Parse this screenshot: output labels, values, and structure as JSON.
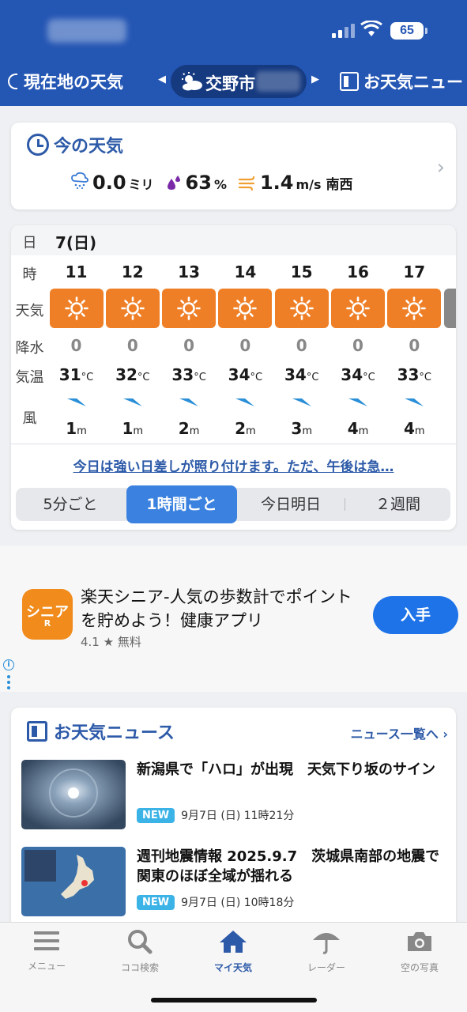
{
  "status_bar": {
    "battery": "65"
  },
  "nav": {
    "left_label": "現在地の天気",
    "city": "交野市",
    "right_label": "お天気ニュー"
  },
  "current": {
    "title": "今の天気",
    "precip_value": "0.0",
    "precip_unit": "ミリ",
    "humidity_value": "63",
    "humidity_unit": "%",
    "wind_value": "1.4",
    "wind_unit": "m/s",
    "wind_dir": "南西"
  },
  "hourly": {
    "labels": {
      "day": "日",
      "hour": "時",
      "weather": "天気",
      "rain": "降水",
      "temp": "気温",
      "wind": "風"
    },
    "day": "7(日)",
    "temp_unit": "°C",
    "wind_unit": "m",
    "hours": [
      {
        "hour": "11",
        "rain": "0",
        "temp": "31",
        "wind": "1"
      },
      {
        "hour": "12",
        "rain": "0",
        "temp": "32",
        "wind": "1"
      },
      {
        "hour": "13",
        "rain": "0",
        "temp": "33",
        "wind": "2"
      },
      {
        "hour": "14",
        "rain": "0",
        "temp": "34",
        "wind": "2"
      },
      {
        "hour": "15",
        "rain": "0",
        "temp": "34",
        "wind": "3"
      },
      {
        "hour": "16",
        "rain": "0",
        "temp": "34",
        "wind": "4"
      },
      {
        "hour": "17",
        "rain": "0",
        "temp": "33",
        "wind": "4"
      }
    ],
    "comment": "今日は強い日差しが照り付けます。ただ、午後は急…",
    "segments": [
      "5分ごと",
      "1時間ごと",
      "今日明日",
      "２週間"
    ],
    "active_segment": "1時間ごと"
  },
  "ad": {
    "icon_text": "シニア",
    "icon_sub": "R",
    "title": "楽天シニア-人気の歩数計でポイントを貯めよう！健康アプリ",
    "rating": "4.1 ★ 無料",
    "button": "入手"
  },
  "news": {
    "heading": "お天気ニュース",
    "more": "ニュース一覧へ",
    "items": [
      {
        "title": "新潟県で「ハロ」が出現　天気下り坂のサイン",
        "badge": "NEW",
        "date": "9月7日 (日) 11時21分"
      },
      {
        "title": "週刊地震情報 2025.9.7　茨城県南部の地震で関東のほぼ全域が揺れる",
        "badge": "NEW",
        "date": "9月7日 (日) 10時18分"
      }
    ]
  },
  "tabbar": {
    "items": [
      "メニュー",
      "ココ検索",
      "マイ天気",
      "レーダー",
      "空の写真"
    ],
    "active": "マイ天気"
  },
  "colors": {
    "header_blue": "#2456b4",
    "accent_blue": "#2d5aa8",
    "sunny_orange": "#ef7f26",
    "segment_active": "#3b82e0"
  }
}
